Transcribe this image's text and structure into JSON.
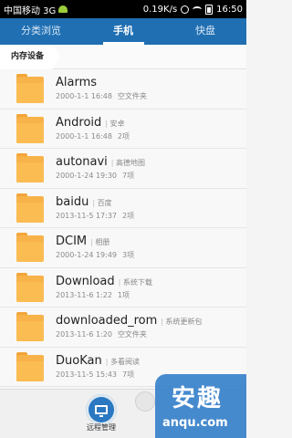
{
  "status": {
    "carrier": "中国移动 3G",
    "speed": "0.19K/s",
    "time": "16:50"
  },
  "tabs": [
    {
      "label": "分类浏览"
    },
    {
      "label": "手机"
    },
    {
      "label": "快盘"
    }
  ],
  "breadcrumb": {
    "label": "内存设备"
  },
  "folders": [
    {
      "name": "Alarms",
      "alias": "",
      "date": "2000-1-1 16:48",
      "count": "空文件夹"
    },
    {
      "name": "Android",
      "alias": "安卓",
      "date": "2000-1-1 16:48",
      "count": "2项"
    },
    {
      "name": "autonavi",
      "alias": "高德地图",
      "date": "2000-1-24 19:30",
      "count": "7项"
    },
    {
      "name": "baidu",
      "alias": "百度",
      "date": "2013-11-5 17:37",
      "count": "2项"
    },
    {
      "name": "DCIM",
      "alias": "相册",
      "date": "2000-1-24 19:49",
      "count": "3项"
    },
    {
      "name": "Download",
      "alias": "系统下载",
      "date": "2013-11-6 1:22",
      "count": "1项"
    },
    {
      "name": "downloaded_rom",
      "alias": "系统更新包",
      "date": "2013-11-6 1:20",
      "count": "空文件夹"
    },
    {
      "name": "DuoKan",
      "alias": "多看阅读",
      "date": "2013-11-5 15:43",
      "count": "7项"
    }
  ],
  "bottom": {
    "remote_label": "远程管理"
  },
  "watermark": {
    "main": "安趣",
    "sub": "anqu.com"
  }
}
